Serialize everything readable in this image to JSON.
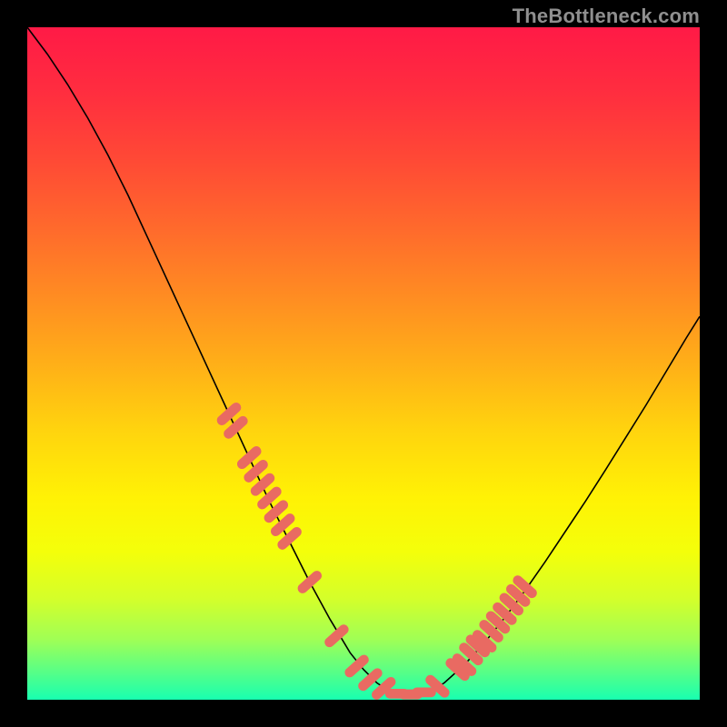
{
  "watermark": "TheBottleneck.com",
  "gradient": {
    "stops": [
      {
        "offset": 0.0,
        "color": "#ff1a46"
      },
      {
        "offset": 0.1,
        "color": "#ff2e3f"
      },
      {
        "offset": 0.2,
        "color": "#ff4a35"
      },
      {
        "offset": 0.3,
        "color": "#ff6a2c"
      },
      {
        "offset": 0.4,
        "color": "#ff8c22"
      },
      {
        "offset": 0.5,
        "color": "#ffaf18"
      },
      {
        "offset": 0.6,
        "color": "#ffd40e"
      },
      {
        "offset": 0.7,
        "color": "#fff205"
      },
      {
        "offset": 0.78,
        "color": "#f4ff0a"
      },
      {
        "offset": 0.85,
        "color": "#d4ff2a"
      },
      {
        "offset": 0.91,
        "color": "#a0ff55"
      },
      {
        "offset": 0.96,
        "color": "#55ff88"
      },
      {
        "offset": 1.0,
        "color": "#18ffb0"
      }
    ]
  },
  "chart_data": {
    "type": "line",
    "title": "",
    "xlabel": "",
    "ylabel": "",
    "xlim": [
      0,
      100
    ],
    "ylim": [
      0,
      100
    ],
    "series": [
      {
        "name": "curve",
        "stroke": "#000000",
        "stroke_width": 1.6,
        "x": [
          0,
          3,
          6,
          9,
          12,
          15,
          18,
          21,
          24,
          27,
          30,
          33,
          36,
          39,
          42,
          45,
          48,
          50,
          52,
          54,
          56,
          58,
          60,
          62,
          65,
          68,
          71,
          74,
          77,
          80,
          83,
          86,
          89,
          92,
          95,
          98,
          100
        ],
        "y": [
          100,
          96,
          91.5,
          86.5,
          81,
          75,
          68.5,
          62,
          55.5,
          49,
          42.5,
          36,
          29.5,
          23.5,
          17.5,
          12,
          7,
          4.5,
          2.5,
          1.2,
          0.8,
          0.8,
          1.3,
          2.5,
          5.2,
          8.5,
          12.2,
          16.2,
          20.5,
          25,
          29.5,
          34.2,
          39,
          43.8,
          48.8,
          53.8,
          57
        ]
      }
    ],
    "highlight_points": {
      "color": "#e96a62",
      "radius": 6,
      "interval_x": [
        30,
        65
      ],
      "points": [
        {
          "x": 30,
          "y": 42.5
        },
        {
          "x": 33,
          "y": 36
        },
        {
          "x": 35,
          "y": 32
        },
        {
          "x": 38,
          "y": 26
        },
        {
          "x": 42,
          "y": 17.5
        },
        {
          "x": 46,
          "y": 9.5
        },
        {
          "x": 49,
          "y": 5
        },
        {
          "x": 51,
          "y": 3
        },
        {
          "x": 53,
          "y": 1.7
        },
        {
          "x": 55,
          "y": 0.9
        },
        {
          "x": 57,
          "y": 0.8
        },
        {
          "x": 59,
          "y": 1.1
        },
        {
          "x": 61,
          "y": 2
        },
        {
          "x": 64,
          "y": 4.5
        }
      ]
    },
    "right_segment_points": {
      "color": "#e96a62",
      "radius": 6,
      "points": [
        {
          "x": 65,
          "y": 5.2
        },
        {
          "x": 66,
          "y": 6.8
        },
        {
          "x": 67,
          "y": 8
        },
        {
          "x": 68,
          "y": 8.7
        },
        {
          "x": 69,
          "y": 10.2
        },
        {
          "x": 70,
          "y": 11.5
        },
        {
          "x": 71,
          "y": 12.8
        },
        {
          "x": 72,
          "y": 14.2
        },
        {
          "x": 73,
          "y": 15.5
        },
        {
          "x": 74,
          "y": 16.8
        }
      ]
    },
    "left_segment_points": {
      "color": "#e96a62",
      "radius": 6,
      "points": [
        {
          "x": 30,
          "y": 42.5
        },
        {
          "x": 31,
          "y": 40.5
        },
        {
          "x": 33,
          "y": 36
        },
        {
          "x": 34,
          "y": 34
        },
        {
          "x": 36,
          "y": 30
        },
        {
          "x": 37,
          "y": 28
        },
        {
          "x": 39,
          "y": 24
        }
      ]
    }
  }
}
